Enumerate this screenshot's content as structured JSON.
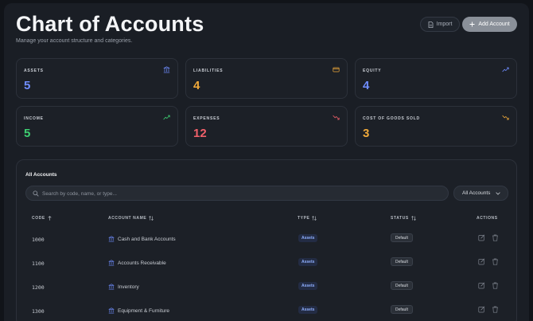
{
  "header": {
    "title": "Chart of Accounts",
    "subtitle": "Manage your account structure and categories.",
    "import_label": "Import",
    "add_label": "Add Account"
  },
  "summary_cards": [
    {
      "label": "ASSETS",
      "value": "5",
      "color": "#6f8dff",
      "icon": "bank-icon"
    },
    {
      "label": "LIABILITIES",
      "value": "4",
      "color": "#f0a93a",
      "icon": "credit-card-icon"
    },
    {
      "label": "EQUITY",
      "value": "4",
      "color": "#6f8dff",
      "icon": "trending-up-icon"
    },
    {
      "label": "INCOME",
      "value": "5",
      "color": "#3ecf72",
      "icon": "trending-up-icon"
    },
    {
      "label": "EXPENSES",
      "value": "12",
      "color": "#f0606a",
      "icon": "trending-down-icon"
    },
    {
      "label": "COST OF GOODS SOLD",
      "value": "3",
      "color": "#f0a93a",
      "icon": "trending-down-icon"
    }
  ],
  "accounts_panel": {
    "title": "All Accounts",
    "search_placeholder": "Search by code, name, or type...",
    "filter_value": "All Accounts",
    "columns": {
      "code": "CODE",
      "name": "ACCOUNT NAME",
      "type": "TYPE",
      "status": "STATUS",
      "actions": "ACTIONS"
    },
    "rows": [
      {
        "code": "1000",
        "name": "Cash and Bank Accounts",
        "type": "Assets",
        "status": "Default"
      },
      {
        "code": "1100",
        "name": "Accounts Receivable",
        "type": "Assets",
        "status": "Default"
      },
      {
        "code": "1200",
        "name": "Inventory",
        "type": "Assets",
        "status": "Default"
      },
      {
        "code": "1300",
        "name": "Equipment & Furniture",
        "type": "Assets",
        "status": "Default"
      }
    ]
  },
  "colors": {
    "background": "#111419",
    "surface": "#1c2027",
    "accent_blue": "#6f8dff",
    "accent_green": "#3ecf72",
    "accent_red": "#f0606a",
    "accent_amber": "#f0a93a"
  }
}
